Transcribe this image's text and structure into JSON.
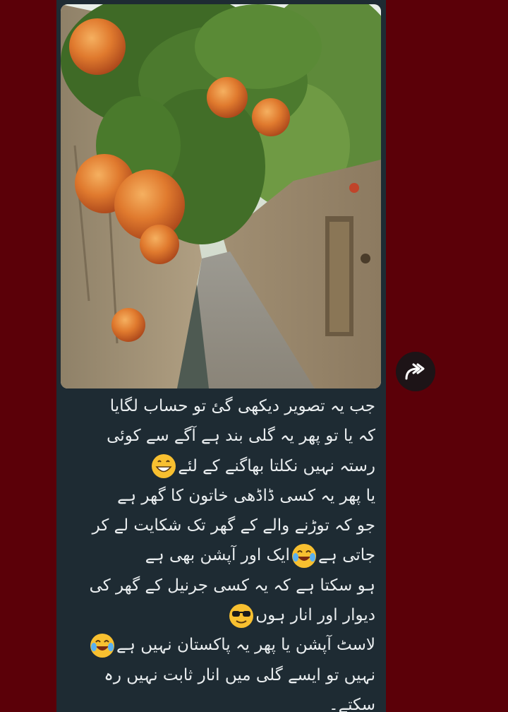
{
  "message": {
    "image_alt": "Narrow mud-walled alley with pomegranate trees",
    "caption_lines": [
      "جب یہ تصویر دیکھی گئ تو حساب لگایا",
      "کہ یا تو پھر یہ گلی بند ہے آگے سے کوئی",
      "رستہ نہیں نکلتا بھاگنے کے لئے",
      "یا پھر یہ کسی ڈاڈھی خاتون کا گھر ہے",
      "جو کہ توڑنے والے کے گھر تک شکایت لے کر",
      "جاتی ہے",
      "ایک اور آپشن بھی ہے",
      "ہو سکتا ہے کہ یہ کسی جرنیل کے گھر کی",
      "دیوار اور انار ہوں",
      "لاسٹ آپشن یا پھر یہ پاکستان نہیں ہے",
      "نہیں تو ایسے گلی میں انار ثابت نہیں رہ",
      "سکتے۔"
    ],
    "emojis": {
      "grin": "grinning-face-emoji",
      "laugh": "tears-of-joy-emoji",
      "cool": "sunglasses-face-emoji"
    }
  },
  "colors": {
    "background": "#5b0008",
    "bubble": "#1e2b33",
    "text": "#e9edef",
    "forward_button": "#1d1417"
  },
  "forward_button": {
    "icon": "forward-arrow-icon"
  }
}
